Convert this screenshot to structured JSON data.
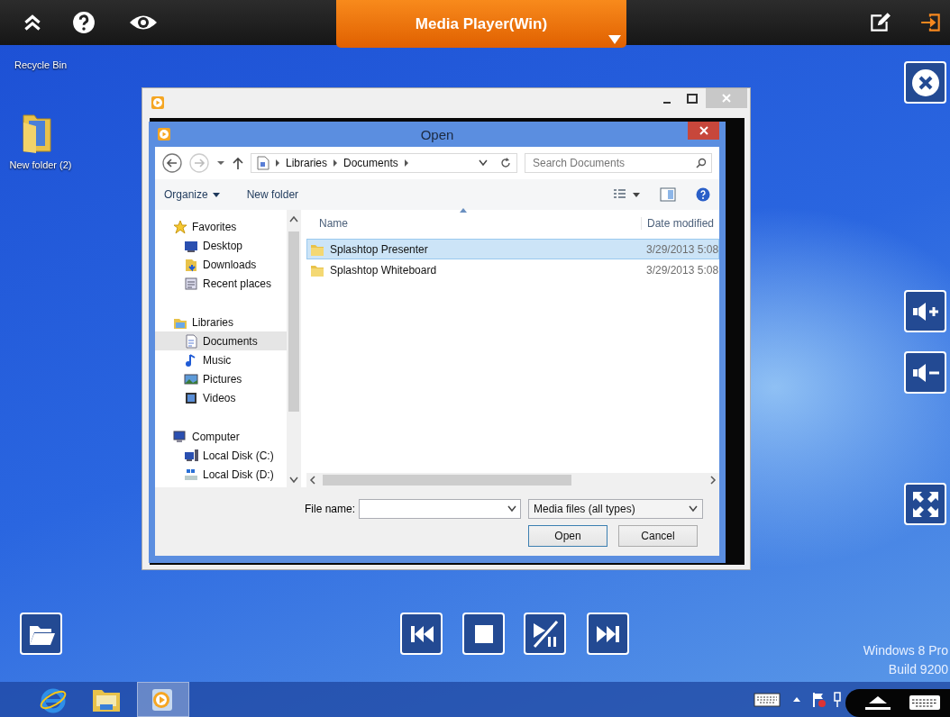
{
  "top_bar": {
    "title": "Media Player(Win)"
  },
  "desktop_icons": [
    {
      "label": "Recycle Bin"
    },
    {
      "label": "New folder (2)"
    }
  ],
  "open_dialog": {
    "title": "Open",
    "address": [
      "Libraries",
      "Documents"
    ],
    "search": {
      "placeholder": "Search Documents"
    },
    "commands": [
      "Organize",
      "New folder"
    ],
    "navigation": [
      {
        "label": "Favorites",
        "selected": false,
        "children": [
          {
            "label": "Desktop",
            "selected": false
          },
          {
            "label": "Downloads",
            "selected": false
          },
          {
            "label": "Recent places",
            "selected": false
          }
        ]
      },
      {
        "label": "Libraries",
        "selected": false,
        "children": [
          {
            "label": "Documents",
            "selected": true
          },
          {
            "label": "Music",
            "selected": false
          },
          {
            "label": "Pictures",
            "selected": false
          },
          {
            "label": "Videos",
            "selected": false
          }
        ]
      },
      {
        "label": "Computer",
        "selected": false,
        "children": [
          {
            "label": "Local Disk (C:)",
            "selected": false
          },
          {
            "label": "Local Disk (D:)",
            "selected": false
          }
        ]
      }
    ],
    "columns": [
      "Name",
      "Date modified"
    ],
    "rows": [
      {
        "name": "Splashtop Presenter",
        "date": "3/29/2013 5:08",
        "selected": true
      },
      {
        "name": "Splashtop Whiteboard",
        "date": "3/29/2013 5:08",
        "selected": false
      }
    ],
    "file_name_label": "File name:",
    "file_type": "Media files (all types)",
    "buttons": [
      "Open",
      "Cancel"
    ]
  },
  "os_watermark": [
    "Windows 8 Pro",
    "Build 9200"
  ]
}
